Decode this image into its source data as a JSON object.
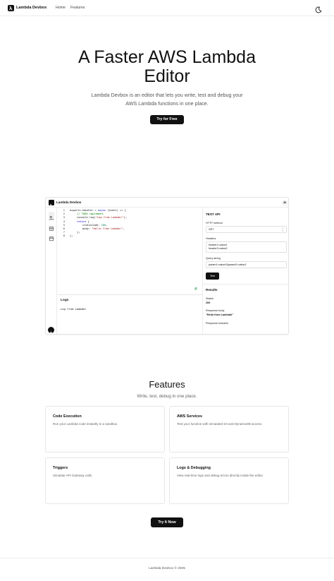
{
  "nav": {
    "brand": "Lambda Devbox",
    "links": [
      "Home",
      "Features"
    ]
  },
  "hero": {
    "title_line1": "A Faster AWS Lambda",
    "title_line2": "Editor",
    "subtitle_line1": "Lambda Devbox is an editor that lets you write, test and debug your",
    "subtitle_line2": "AWS Lambda functions in one place.",
    "cta": "Try for Free"
  },
  "app": {
    "brand": "Lambda Devbox",
    "avatar": "JU",
    "code": {
      "line_numbers": [
        "1",
        "2",
        "3",
        "4",
        "5",
        "6",
        "7",
        "8"
      ],
      "l1_a": "exports.handler = ",
      "l1_b": "async",
      "l1_c": " (event) => {",
      "l2": "// TODO implement",
      "l3_a": "console.log(",
      "l3_b": "\"Log from Lambda!\"",
      "l3_c": ");",
      "l4_a": "return",
      "l4_b": " {",
      "l5_a": "statusCode: ",
      "l5_b": "200",
      "l5_c": ",",
      "l6_a": "body: ",
      "l6_b": "\"Hello from Lambda!\"",
      "l6_c": ",",
      "l7": "};",
      "l8": "};"
    },
    "logs": {
      "title": "Logs",
      "text": "Log from Lambda!"
    },
    "test": {
      "title": "TEST API",
      "method_label": "HTTP method",
      "method_value": "GET",
      "headers_label": "Headers",
      "headers_line1": "header1=value1",
      "headers_line2": "header2=value2",
      "query_label": "Query string",
      "query_value": "param1=value1&param2=value2",
      "button": "Test"
    },
    "results": {
      "title": "Results",
      "status_label": "Status",
      "status_value": "200",
      "body_label": "Response body",
      "body_value": "\"Hello from Lambda!\"",
      "headers_label": "Response headers"
    }
  },
  "features": {
    "title": "Features",
    "subtitle": "Write, test, debug in one place.",
    "cards": [
      {
        "title": "Code Execution",
        "desc": "Run your Lambda code instantly in a sandbox."
      },
      {
        "title": "AWS Services",
        "desc": "Test your function with simulated S3 and DynamoDB access."
      },
      {
        "title": "Triggers",
        "desc": "Simulate API Gateway calls."
      },
      {
        "title": "Logs & Debugging",
        "desc": "View real-time logs and debug errors directly inside the editor."
      }
    ],
    "cta": "Try It Now"
  },
  "footer": {
    "text": "Lambda Devbox © 2025"
  }
}
